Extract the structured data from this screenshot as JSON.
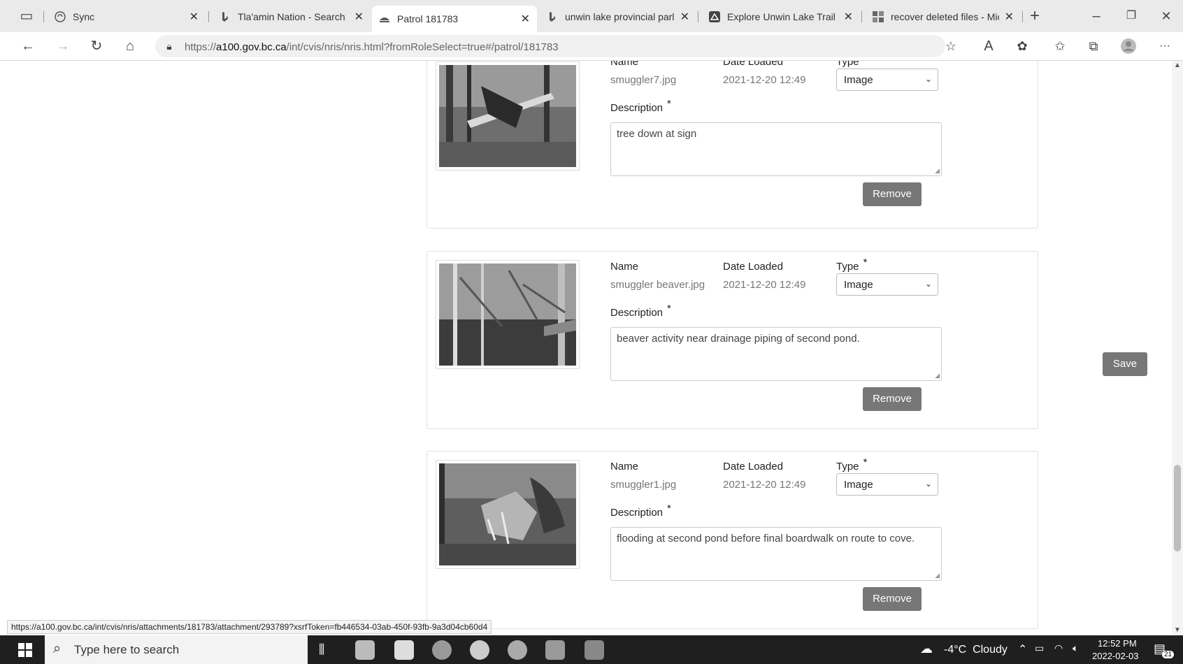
{
  "tabs": [
    {
      "label": "Sync",
      "icon": "sync-icon",
      "active": false
    },
    {
      "label": "Tla'amin Nation - Search",
      "icon": "bing-icon",
      "active": false
    },
    {
      "label": "Patrol 181783",
      "icon": "bc-gov-icon",
      "active": true
    },
    {
      "label": "unwin lake provincial parl",
      "icon": "bing-icon",
      "active": false
    },
    {
      "label": "Explore Unwin Lake Trail | A",
      "icon": "alltrails-icon",
      "active": false
    },
    {
      "label": "recover deleted files - Micr",
      "icon": "microsoft-icon",
      "active": false
    }
  ],
  "address_bar": {
    "url_prefix": "https://",
    "url_domain": "a100.gov.bc.ca",
    "url_path": "/int/cvis/nris/nris.html?fromRoleSelect=true#/patrol/181783"
  },
  "attachment_labels": {
    "name": "Name",
    "date_loaded": "Date Loaded",
    "type": "Type",
    "description": "Description",
    "required_marker": "*",
    "remove": "Remove"
  },
  "attachments": [
    {
      "name": "smuggler7.jpg",
      "date_loaded": "2021-12-20 12:49",
      "type": "Image",
      "description": "tree down at sign"
    },
    {
      "name": "smuggler beaver.jpg",
      "date_loaded": "2021-12-20 12:49",
      "type": "Image",
      "description": "beaver activity near drainage piping of second pond."
    },
    {
      "name": "smuggler1.jpg",
      "date_loaded": "2021-12-20 12:49",
      "type": "Image",
      "description": "flooding at second pond before final boardwalk on route to cove."
    }
  ],
  "save_label": "Save",
  "status_url": "https://a100.gov.bc.ca/int/cvis/nris/attachments/181783/attachment/293789?xsrfToken=fb446534-03ab-450f-93fb-9a3d04cb60d4",
  "taskbar": {
    "search_placeholder": "Type here to search",
    "weather": "-4°C  Cloudy",
    "time": "12:52 PM",
    "date": "2022-02-03",
    "notification_count": "21"
  }
}
